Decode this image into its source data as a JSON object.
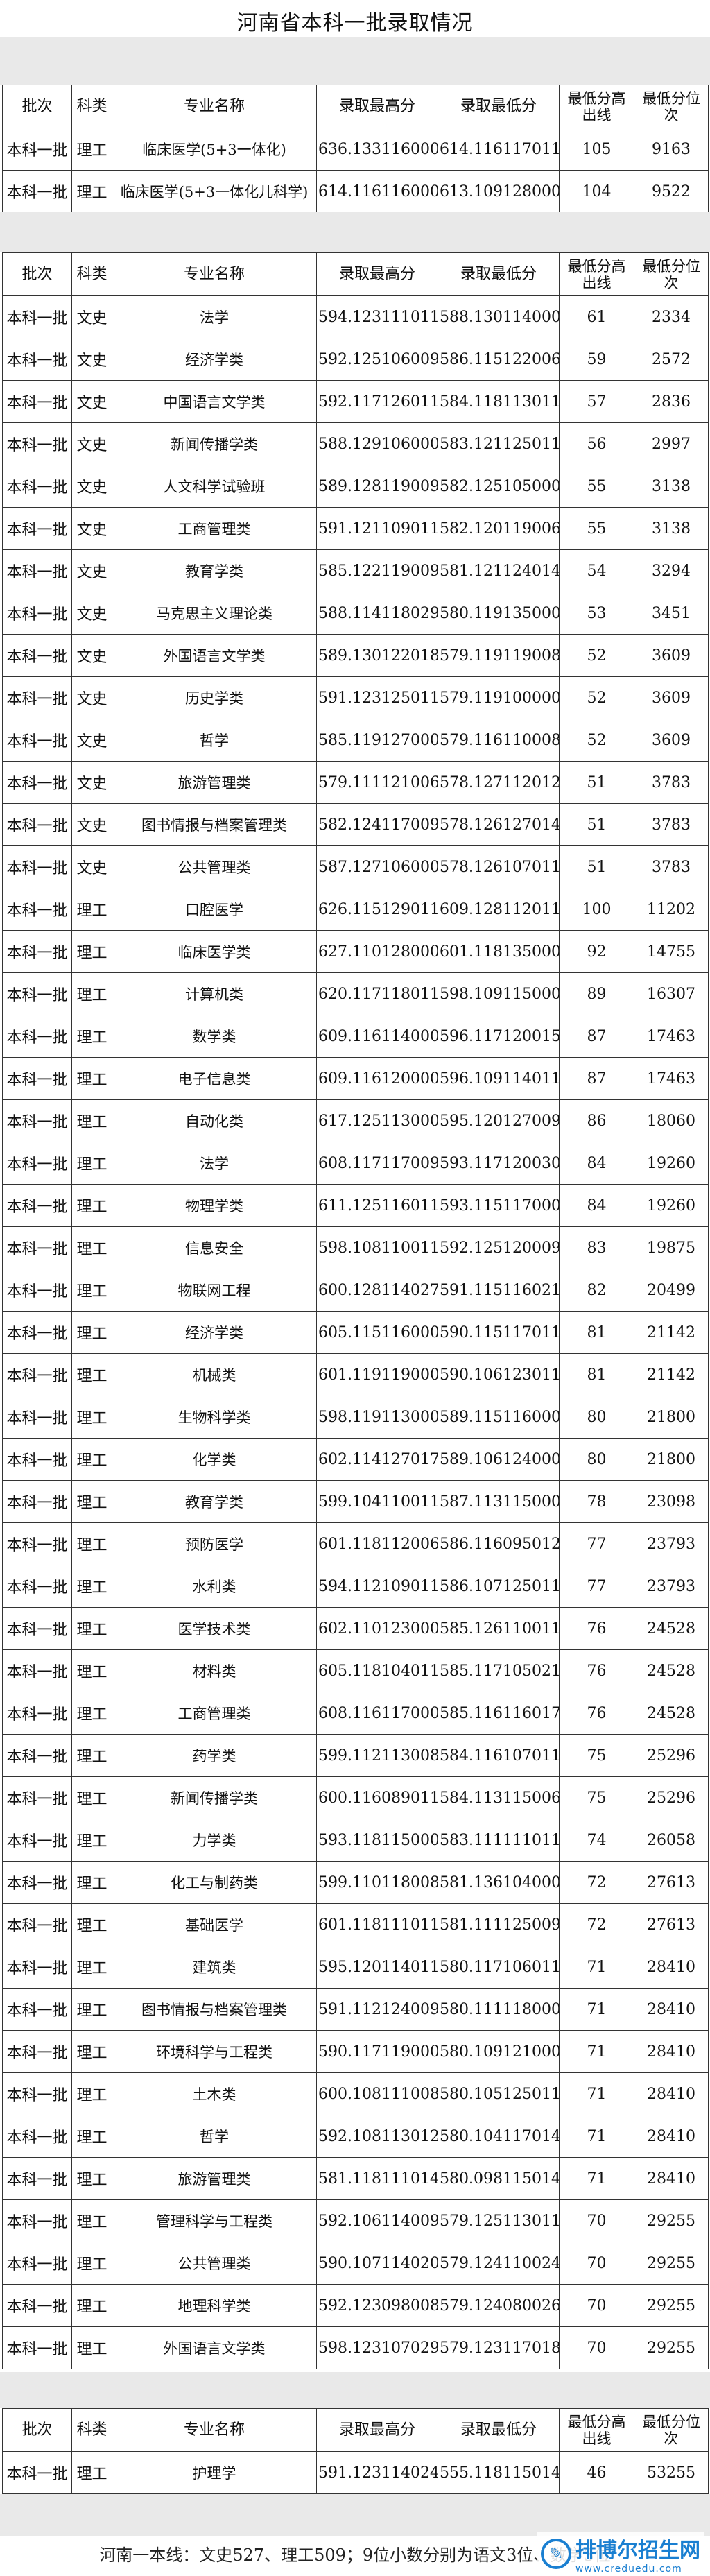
{
  "page": {
    "title": "河南省本科一批录取情况"
  },
  "columns": {
    "batch": "批次",
    "category": "科类",
    "major": "专业名称",
    "max_score": "录取最高分",
    "min_score": "录取最低分",
    "diff_above_line": "最低分高出线",
    "min_rank": "最低分位次"
  },
  "table1": {
    "rows": [
      {
        "batch": "本科一批",
        "category": "理工",
        "major": "临床医学(5+3一体化)",
        "max": "636.133116000",
        "min": "614.116117011",
        "diff": "105",
        "rank": "9163"
      },
      {
        "batch": "本科一批",
        "category": "理工",
        "major": "临床医学(5+3一体化儿科学)",
        "max": "614.116116000",
        "min": "613.109128000",
        "diff": "104",
        "rank": "9522"
      }
    ]
  },
  "table2": {
    "rows": [
      {
        "batch": "本科一批",
        "category": "文史",
        "major": "法学",
        "max": "594.123111011",
        "min": "588.130114000",
        "diff": "61",
        "rank": "2334"
      },
      {
        "batch": "本科一批",
        "category": "文史",
        "major": "经济学类",
        "max": "592.125106009",
        "min": "586.115122006",
        "diff": "59",
        "rank": "2572"
      },
      {
        "batch": "本科一批",
        "category": "文史",
        "major": "中国语言文学类",
        "max": "592.117126011",
        "min": "584.118113011",
        "diff": "57",
        "rank": "2836"
      },
      {
        "batch": "本科一批",
        "category": "文史",
        "major": "新闻传播学类",
        "max": "588.129106000",
        "min": "583.121125011",
        "diff": "56",
        "rank": "2997"
      },
      {
        "batch": "本科一批",
        "category": "文史",
        "major": "人文科学试验班",
        "max": "589.128119009",
        "min": "582.125105000",
        "diff": "55",
        "rank": "3138"
      },
      {
        "batch": "本科一批",
        "category": "文史",
        "major": "工商管理类",
        "max": "591.121109011",
        "min": "582.120119006",
        "diff": "55",
        "rank": "3138"
      },
      {
        "batch": "本科一批",
        "category": "文史",
        "major": "教育学类",
        "max": "585.122119009",
        "min": "581.121124014",
        "diff": "54",
        "rank": "3294"
      },
      {
        "batch": "本科一批",
        "category": "文史",
        "major": "马克思主义理论类",
        "max": "588.114118029",
        "min": "580.119135000",
        "diff": "53",
        "rank": "3451"
      },
      {
        "batch": "本科一批",
        "category": "文史",
        "major": "外国语言文学类",
        "max": "589.130122018",
        "min": "579.119119008",
        "diff": "52",
        "rank": "3609"
      },
      {
        "batch": "本科一批",
        "category": "文史",
        "major": "历史学类",
        "max": "591.123125011",
        "min": "579.119100000",
        "diff": "52",
        "rank": "3609"
      },
      {
        "batch": "本科一批",
        "category": "文史",
        "major": "哲学",
        "max": "585.119127000",
        "min": "579.116110008",
        "diff": "52",
        "rank": "3609"
      },
      {
        "batch": "本科一批",
        "category": "文史",
        "major": "旅游管理类",
        "max": "579.111121006",
        "min": "578.127112012",
        "diff": "51",
        "rank": "3783"
      },
      {
        "batch": "本科一批",
        "category": "文史",
        "major": "图书情报与档案管理类",
        "max": "582.124117009",
        "min": "578.126127014",
        "diff": "51",
        "rank": "3783"
      },
      {
        "batch": "本科一批",
        "category": "文史",
        "major": "公共管理类",
        "max": "587.127106000",
        "min": "578.126107011",
        "diff": "51",
        "rank": "3783"
      },
      {
        "batch": "本科一批",
        "category": "理工",
        "major": "口腔医学",
        "max": "626.115129011",
        "min": "609.128112011",
        "diff": "100",
        "rank": "11202"
      },
      {
        "batch": "本科一批",
        "category": "理工",
        "major": "临床医学类",
        "max": "627.110128000",
        "min": "601.118135000",
        "diff": "92",
        "rank": "14755"
      },
      {
        "batch": "本科一批",
        "category": "理工",
        "major": "计算机类",
        "max": "620.117118011",
        "min": "598.109115000",
        "diff": "89",
        "rank": "16307"
      },
      {
        "batch": "本科一批",
        "category": "理工",
        "major": "数学类",
        "max": "609.116114000",
        "min": "596.117120015",
        "diff": "87",
        "rank": "17463"
      },
      {
        "batch": "本科一批",
        "category": "理工",
        "major": "电子信息类",
        "max": "609.116120000",
        "min": "596.109114011",
        "diff": "87",
        "rank": "17463"
      },
      {
        "batch": "本科一批",
        "category": "理工",
        "major": "自动化类",
        "max": "617.125113000",
        "min": "595.120127009",
        "diff": "86",
        "rank": "18060"
      },
      {
        "batch": "本科一批",
        "category": "理工",
        "major": "法学",
        "max": "608.117117009",
        "min": "593.117120030",
        "diff": "84",
        "rank": "19260"
      },
      {
        "batch": "本科一批",
        "category": "理工",
        "major": "物理学类",
        "max": "611.125116011",
        "min": "593.115117000",
        "diff": "84",
        "rank": "19260"
      },
      {
        "batch": "本科一批",
        "category": "理工",
        "major": "信息安全",
        "max": "598.108110011",
        "min": "592.125120009",
        "diff": "83",
        "rank": "19875"
      },
      {
        "batch": "本科一批",
        "category": "理工",
        "major": "物联网工程",
        "max": "600.128114027",
        "min": "591.115116021",
        "diff": "82",
        "rank": "20499"
      },
      {
        "batch": "本科一批",
        "category": "理工",
        "major": "经济学类",
        "max": "605.115116000",
        "min": "590.115117011",
        "diff": "81",
        "rank": "21142"
      },
      {
        "batch": "本科一批",
        "category": "理工",
        "major": "机械类",
        "max": "601.119119000",
        "min": "590.106123011",
        "diff": "81",
        "rank": "21142"
      },
      {
        "batch": "本科一批",
        "category": "理工",
        "major": "生物科学类",
        "max": "598.119113000",
        "min": "589.115116000",
        "diff": "80",
        "rank": "21800"
      },
      {
        "batch": "本科一批",
        "category": "理工",
        "major": "化学类",
        "max": "602.114127017",
        "min": "589.106124000",
        "diff": "80",
        "rank": "21800"
      },
      {
        "batch": "本科一批",
        "category": "理工",
        "major": "教育学类",
        "max": "599.104110011",
        "min": "587.113115000",
        "diff": "78",
        "rank": "23098"
      },
      {
        "batch": "本科一批",
        "category": "理工",
        "major": "预防医学",
        "max": "601.118112006",
        "min": "586.116095012",
        "diff": "77",
        "rank": "23793"
      },
      {
        "batch": "本科一批",
        "category": "理工",
        "major": "水利类",
        "max": "594.112109011",
        "min": "586.107125011",
        "diff": "77",
        "rank": "23793"
      },
      {
        "batch": "本科一批",
        "category": "理工",
        "major": "医学技术类",
        "max": "602.110123000",
        "min": "585.126110011",
        "diff": "76",
        "rank": "24528"
      },
      {
        "batch": "本科一批",
        "category": "理工",
        "major": "材料类",
        "max": "605.118104011",
        "min": "585.117105021",
        "diff": "76",
        "rank": "24528"
      },
      {
        "batch": "本科一批",
        "category": "理工",
        "major": "工商管理类",
        "max": "608.116117000",
        "min": "585.116116017",
        "diff": "76",
        "rank": "24528"
      },
      {
        "batch": "本科一批",
        "category": "理工",
        "major": "药学类",
        "max": "599.112113008",
        "min": "584.116107011",
        "diff": "75",
        "rank": "25296"
      },
      {
        "batch": "本科一批",
        "category": "理工",
        "major": "新闻传播学类",
        "max": "600.116089011",
        "min": "584.113115006",
        "diff": "75",
        "rank": "25296"
      },
      {
        "batch": "本科一批",
        "category": "理工",
        "major": "力学类",
        "max": "593.118115000",
        "min": "583.111111011",
        "diff": "74",
        "rank": "26058"
      },
      {
        "batch": "本科一批",
        "category": "理工",
        "major": "化工与制药类",
        "max": "599.110118008",
        "min": "581.136104000",
        "diff": "72",
        "rank": "27613"
      },
      {
        "batch": "本科一批",
        "category": "理工",
        "major": "基础医学",
        "max": "601.118111011",
        "min": "581.111125009",
        "diff": "72",
        "rank": "27613"
      },
      {
        "batch": "本科一批",
        "category": "理工",
        "major": "建筑类",
        "max": "595.120114011",
        "min": "580.117106011",
        "diff": "71",
        "rank": "28410"
      },
      {
        "batch": "本科一批",
        "category": "理工",
        "major": "图书情报与档案管理类",
        "max": "591.112124009",
        "min": "580.111118000",
        "diff": "71",
        "rank": "28410"
      },
      {
        "batch": "本科一批",
        "category": "理工",
        "major": "环境科学与工程类",
        "max": "590.117119000",
        "min": "580.109121000",
        "diff": "71",
        "rank": "28410"
      },
      {
        "batch": "本科一批",
        "category": "理工",
        "major": "土木类",
        "max": "600.108111008",
        "min": "580.105125011",
        "diff": "71",
        "rank": "28410"
      },
      {
        "batch": "本科一批",
        "category": "理工",
        "major": "哲学",
        "max": "592.108113012",
        "min": "580.104117014",
        "diff": "71",
        "rank": "28410"
      },
      {
        "batch": "本科一批",
        "category": "理工",
        "major": "旅游管理类",
        "max": "581.118111014",
        "min": "580.098115014",
        "diff": "71",
        "rank": "28410"
      },
      {
        "batch": "本科一批",
        "category": "理工",
        "major": "管理科学与工程类",
        "max": "592.106114009",
        "min": "579.125113011",
        "diff": "70",
        "rank": "29255"
      },
      {
        "batch": "本科一批",
        "category": "理工",
        "major": "公共管理类",
        "max": "590.107114020",
        "min": "579.124110024",
        "diff": "70",
        "rank": "29255"
      },
      {
        "batch": "本科一批",
        "category": "理工",
        "major": "地理科学类",
        "max": "592.123098008",
        "min": "579.124080026",
        "diff": "70",
        "rank": "29255"
      },
      {
        "batch": "本科一批",
        "category": "理工",
        "major": "外国语言文学类",
        "max": "598.123107029",
        "min": "579.123117018",
        "diff": "70",
        "rank": "29255"
      }
    ]
  },
  "table3": {
    "rows": [
      {
        "batch": "本科一批",
        "category": "理工",
        "major": "护理学",
        "max": "591.123114024",
        "min": "555.118115014",
        "diff": "46",
        "rank": "53255"
      }
    ]
  },
  "footer": {
    "note": "河南一本线：文史527、理工509；9位小数分别为语文3位、数学3位"
  },
  "watermark": {
    "icon": "logo-icon",
    "text": "排博尔招生网",
    "sub": "www.creduedu.com"
  }
}
